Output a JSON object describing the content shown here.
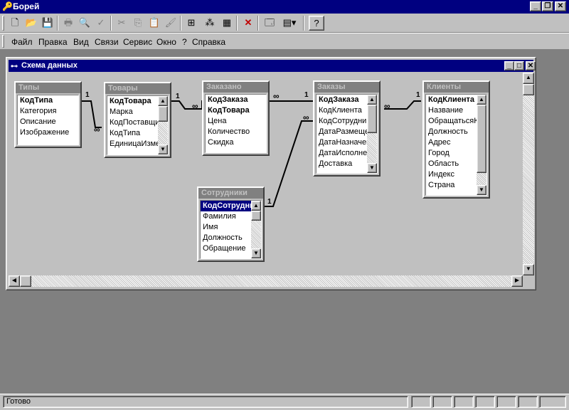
{
  "app": {
    "title": "Борей"
  },
  "toolbar": {
    "buttons": [
      "new-icon",
      "open-icon",
      "save-icon",
      "print-icon",
      "preview-icon",
      "spelling-icon",
      "cut-icon",
      "copy-icon",
      "paste-icon",
      "format-painter-icon",
      "show-table-icon",
      "direct-relationships-icon",
      "all-relationships-icon",
      "delete-icon",
      "database-window-icon",
      "new-object-icon",
      "help-icon"
    ]
  },
  "menu": [
    "Файл",
    "Правка",
    "Вид",
    "Связи",
    "Сервис",
    "Окно",
    "?",
    "Справка"
  ],
  "child": {
    "title": "Схема данных"
  },
  "tables": [
    {
      "name": "Типы",
      "fields": [
        "КодТипа",
        "Категория",
        "Описание",
        "Изображение"
      ],
      "pk": [
        0
      ]
    },
    {
      "name": "Товары",
      "fields": [
        "КодТовара",
        "Марка",
        "КодПоставщика",
        "КодТипа",
        "ЕдиницаИзмерения"
      ],
      "pk": [
        0
      ]
    },
    {
      "name": "Заказано",
      "fields": [
        "КодЗаказа",
        "КодТовара",
        "Цена",
        "Количество",
        "Скидка"
      ],
      "pk": [
        0,
        1
      ]
    },
    {
      "name": "Заказы",
      "fields": [
        "КодЗаказа",
        "КодКлиента",
        "КодСотрудника",
        "ДатаРазмещения",
        "ДатаНазначения",
        "ДатаИсполнения",
        "Доставка"
      ],
      "pk": [
        0
      ]
    },
    {
      "name": "Клиенты",
      "fields": [
        "КодКлиента",
        "Название",
        "ОбращатьсяК",
        "Должность",
        "Адрес",
        "Город",
        "Область",
        "Индекс",
        "Страна"
      ],
      "pk": [
        0
      ]
    },
    {
      "name": "Сотрудники",
      "fields": [
        "КодСотрудника",
        "Фамилия",
        "Имя",
        "Должность",
        "Обращение"
      ],
      "pk": [
        0
      ]
    }
  ],
  "relationships": {
    "one_label": "1",
    "many_label": "∞"
  },
  "status": {
    "text": "Готово"
  }
}
